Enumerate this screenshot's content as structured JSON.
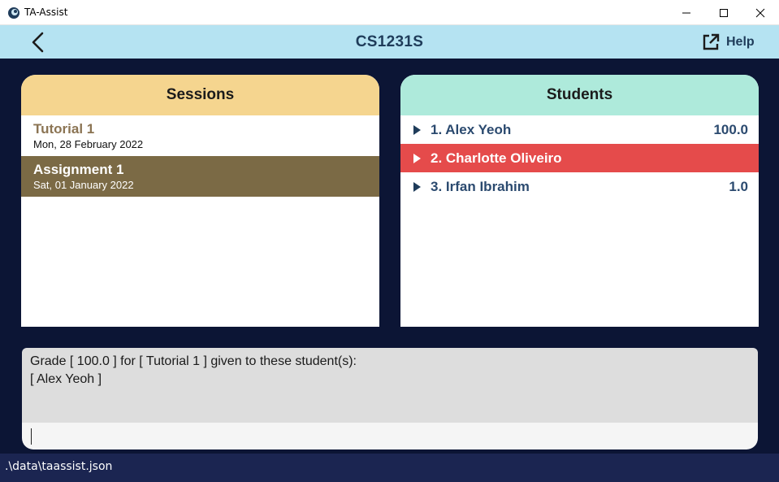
{
  "window": {
    "title": "TA-Assist",
    "icon": "app-logo-icon"
  },
  "header": {
    "title": "CS1231S",
    "help_label": "Help",
    "back_icon": "chevron-left-icon",
    "help_icon": "external-link-icon"
  },
  "sessions": {
    "title": "Sessions",
    "items": [
      {
        "name": "Tutorial 1",
        "date": "Mon, 28 February 2022"
      },
      {
        "name": "Assignment 1",
        "date": "Sat, 01 January 2022"
      }
    ]
  },
  "students": {
    "title": "Students",
    "items": [
      {
        "name": "1. Alex Yeoh",
        "grade": "100.0"
      },
      {
        "name": "2. Charlotte Oliveiro",
        "grade": ""
      },
      {
        "name": "3. Irfan Ibrahim",
        "grade": "1.0"
      }
    ]
  },
  "result": {
    "line1": "Grade [ 100.0 ] for [ Tutorial 1 ] given to these student(s):",
    "line2": "[ Alex Yeoh ]"
  },
  "command": {
    "value": ""
  },
  "status": {
    "path": ".\\data\\taassist.json"
  },
  "colors": {
    "header_bg": "#b5e3f2",
    "main_bg": "#0c1535",
    "sessions_header": "#f5d58f",
    "students_header": "#aeeadb",
    "session_selected": "#7b6a45",
    "student_highlight": "#e54b4b",
    "status_bg": "#1b2551"
  }
}
